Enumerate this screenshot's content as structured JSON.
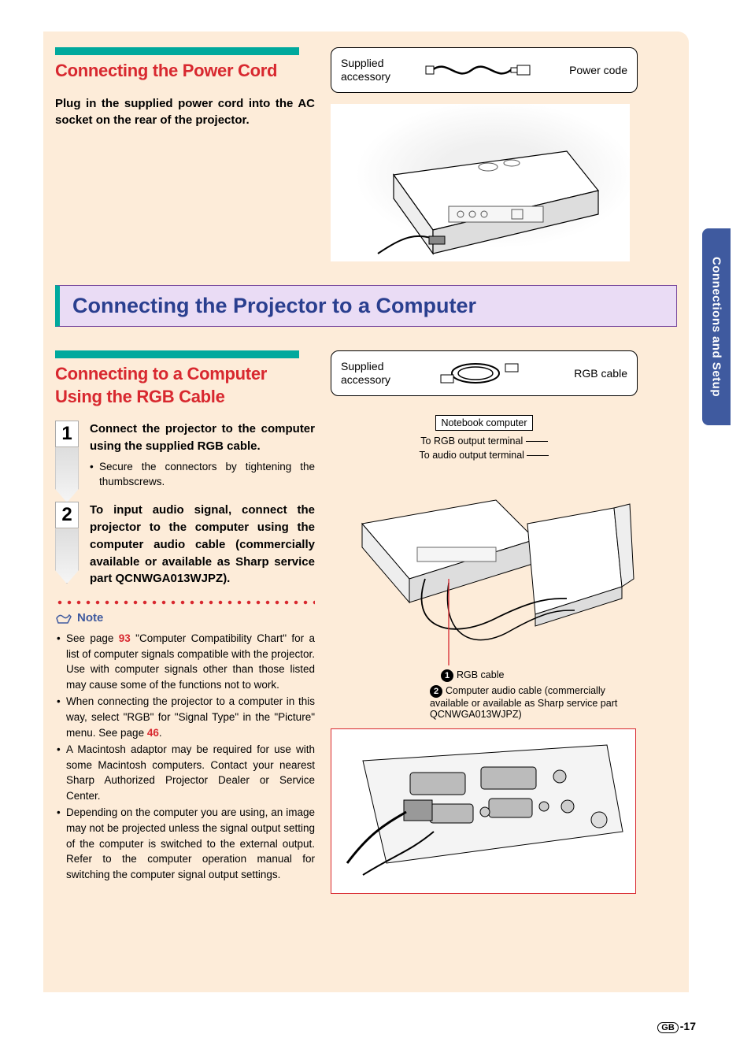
{
  "side_tab": "Connections and Setup",
  "section1": {
    "heading": "Connecting the Power Cord",
    "body": "Plug in the supplied power cord into the AC socket on the rear of the projector.",
    "accessory_label": "Supplied accessory",
    "accessory_item": "Power code"
  },
  "main_heading": "Connecting the Projector to a Computer",
  "section2": {
    "heading": "Connecting to a Computer Using the RGB Cable",
    "accessory_label": "Supplied accessory",
    "accessory_item": "RGB cable",
    "step1_num": "1",
    "step1_title": "Connect the projector to the computer using the supplied RGB cable.",
    "step1_sub": "Secure the connectors by tightening the thumbscrews.",
    "step2_num": "2",
    "step2_title": "To input audio signal, connect the projector to the computer using the computer audio cable (commercially available or available as Sharp service part QCNWGA013WJPZ).",
    "note_label": "Note",
    "notes": {
      "n1a": "See page ",
      "n1_link": "93",
      "n1b": " \"Computer Compatibility Chart\" for a list of computer signals compatible with the projector. Use with computer signals other than those listed may cause some of the functions not to work.",
      "n2a": "When connecting the projector to a computer in this way, select \"RGB\" for \"Signal Type\" in the \"Picture\" menu. See page ",
      "n2_link": "46",
      "n2b": ".",
      "n3": "A Macintosh adaptor may be required for use with some Macintosh computers. Contact your nearest Sharp Authorized Projector Dealer or Service Center.",
      "n4": "Depending on the computer you are using, an image may not be projected unless the signal output setting of the computer is switched to the external output. Refer to the computer operation manual for switching the computer signal output settings."
    },
    "diagram": {
      "notebook_label": "Notebook computer",
      "to_rgb": "To RGB output terminal",
      "to_audio": "To audio output terminal",
      "callout1_num": "1",
      "callout1_text": "RGB cable",
      "callout2_num": "2",
      "callout2_text": "Computer audio cable (commercially available or available as Sharp service part QCNWGA013WJPZ)"
    }
  },
  "footer": {
    "region": "GB",
    "page": "-17"
  }
}
